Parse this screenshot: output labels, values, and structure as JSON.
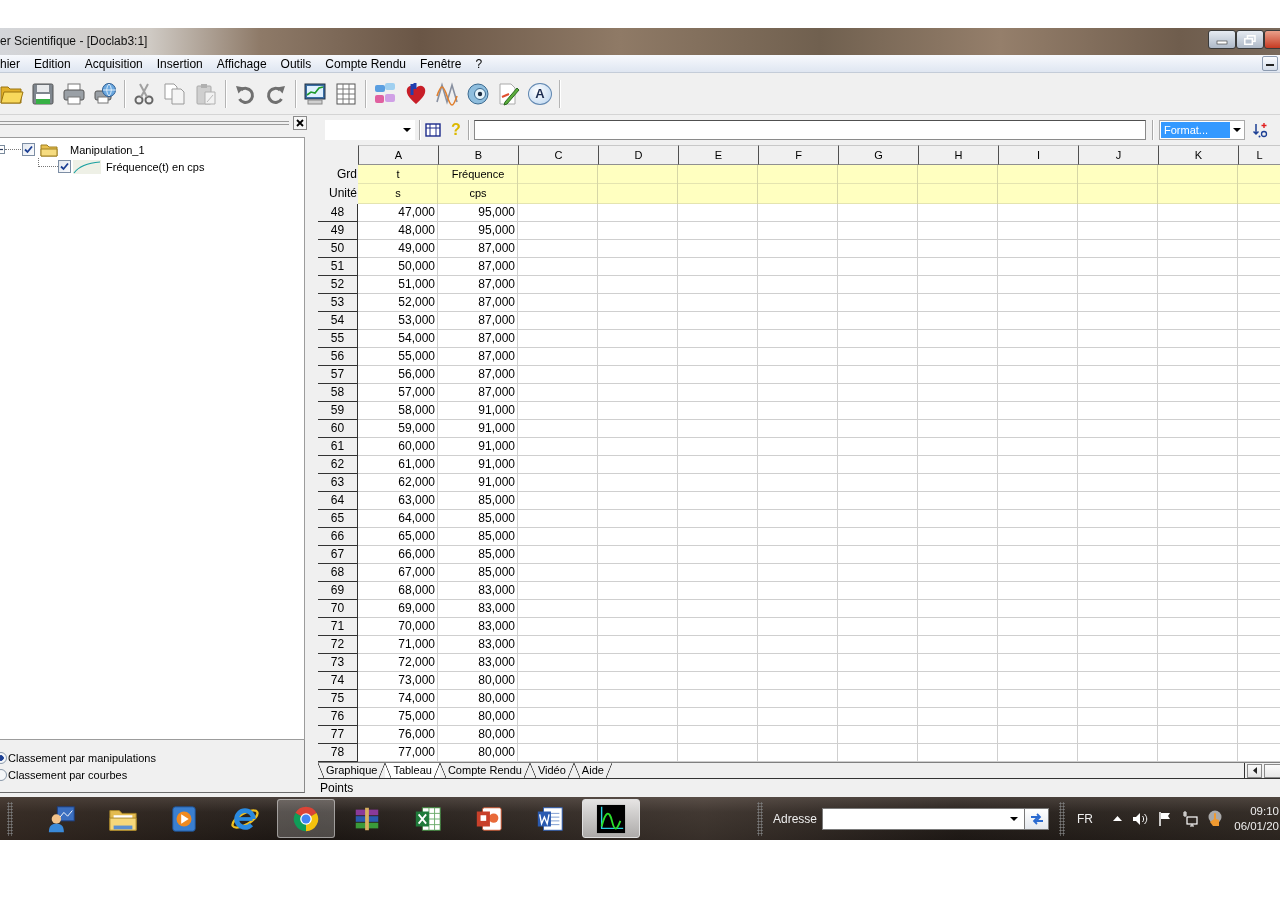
{
  "window": {
    "title": "er Scientifique - [Doclab3:1]"
  },
  "menu": [
    "hier",
    "Edition",
    "Acquisition",
    "Insertion",
    "Affichage",
    "Outils",
    "Compte Rendu",
    "Fenêtre",
    "?"
  ],
  "toolbar": [
    [
      {
        "kind": "open"
      },
      {
        "kind": "save"
      },
      {
        "kind": "print"
      },
      {
        "kind": "print-network"
      }
    ],
    [
      {
        "kind": "cut"
      },
      {
        "kind": "copy"
      },
      {
        "kind": "paste"
      }
    ],
    [
      {
        "kind": "undo"
      },
      {
        "kind": "redo"
      }
    ],
    [
      {
        "kind": "graph"
      },
      {
        "kind": "table"
      }
    ],
    [
      {
        "kind": "modules"
      },
      {
        "kind": "heart"
      },
      {
        "kind": "wave"
      },
      {
        "kind": "webcam"
      },
      {
        "kind": "pen"
      },
      {
        "kind": "text-bubble",
        "label": "A"
      }
    ]
  ],
  "explorer": {
    "tree": [
      {
        "label": "Manipulation_1",
        "checked": true,
        "expanded": true,
        "children": [
          {
            "label": "Fréquence(t) en cps",
            "checked": true
          }
        ]
      }
    ],
    "sort_options": [
      {
        "label": "Classement par manipulations",
        "selected": true
      },
      {
        "label": "Classement par courbes",
        "selected": false
      }
    ]
  },
  "formula_bar": {
    "help": "?",
    "format": "Format..."
  },
  "sheet": {
    "columns": [
      "A",
      "B",
      "C",
      "D",
      "E",
      "F",
      "G",
      "H",
      "I",
      "J",
      "K",
      "L"
    ],
    "header_rows": [
      {
        "label": "Grd",
        "cells": [
          "t",
          "Fréquence"
        ]
      },
      {
        "label": "Unité",
        "cells": [
          "s",
          "cps"
        ]
      }
    ],
    "rows": [
      {
        "number": "48",
        "cells": [
          "47,000",
          "95,000"
        ]
      },
      {
        "number": "49",
        "cells": [
          "48,000",
          "95,000"
        ]
      },
      {
        "number": "50",
        "cells": [
          "49,000",
          "87,000"
        ]
      },
      {
        "number": "51",
        "cells": [
          "50,000",
          "87,000"
        ]
      },
      {
        "number": "52",
        "cells": [
          "51,000",
          "87,000"
        ]
      },
      {
        "number": "53",
        "cells": [
          "52,000",
          "87,000"
        ]
      },
      {
        "number": "54",
        "cells": [
          "53,000",
          "87,000"
        ]
      },
      {
        "number": "55",
        "cells": [
          "54,000",
          "87,000"
        ]
      },
      {
        "number": "56",
        "cells": [
          "55,000",
          "87,000"
        ]
      },
      {
        "number": "57",
        "cells": [
          "56,000",
          "87,000"
        ]
      },
      {
        "number": "58",
        "cells": [
          "57,000",
          "87,000"
        ]
      },
      {
        "number": "59",
        "cells": [
          "58,000",
          "91,000"
        ]
      },
      {
        "number": "60",
        "cells": [
          "59,000",
          "91,000"
        ]
      },
      {
        "number": "61",
        "cells": [
          "60,000",
          "91,000"
        ]
      },
      {
        "number": "62",
        "cells": [
          "61,000",
          "91,000"
        ]
      },
      {
        "number": "63",
        "cells": [
          "62,000",
          "91,000"
        ]
      },
      {
        "number": "64",
        "cells": [
          "63,000",
          "85,000"
        ]
      },
      {
        "number": "65",
        "cells": [
          "64,000",
          "85,000"
        ]
      },
      {
        "number": "66",
        "cells": [
          "65,000",
          "85,000"
        ]
      },
      {
        "number": "67",
        "cells": [
          "66,000",
          "85,000"
        ]
      },
      {
        "number": "68",
        "cells": [
          "67,000",
          "85,000"
        ]
      },
      {
        "number": "69",
        "cells": [
          "68,000",
          "83,000"
        ]
      },
      {
        "number": "70",
        "cells": [
          "69,000",
          "83,000"
        ]
      },
      {
        "number": "71",
        "cells": [
          "70,000",
          "83,000"
        ]
      },
      {
        "number": "72",
        "cells": [
          "71,000",
          "83,000"
        ]
      },
      {
        "number": "73",
        "cells": [
          "72,000",
          "83,000"
        ]
      },
      {
        "number": "74",
        "cells": [
          "73,000",
          "80,000"
        ]
      },
      {
        "number": "75",
        "cells": [
          "74,000",
          "80,000"
        ]
      },
      {
        "number": "76",
        "cells": [
          "75,000",
          "80,000"
        ]
      },
      {
        "number": "77",
        "cells": [
          "76,000",
          "80,000"
        ]
      },
      {
        "number": "78",
        "cells": [
          "77,000",
          "80,000"
        ]
      }
    ]
  },
  "tabs": [
    {
      "label": "Graphique",
      "selected": false
    },
    {
      "label": "Tableau",
      "selected": true
    },
    {
      "label": "Compte Rendu",
      "selected": false
    },
    {
      "label": "Vidéo",
      "selected": false
    },
    {
      "label": "Aide",
      "selected": false
    }
  ],
  "status_bar": {
    "text": "Points"
  },
  "taskbar": {
    "apps": [
      {
        "kind": "person-board",
        "running": false,
        "selected": false
      },
      {
        "kind": "folder",
        "running": false,
        "selected": false
      },
      {
        "kind": "play",
        "running": false,
        "selected": false
      },
      {
        "kind": "e-logo",
        "running": false,
        "selected": false
      },
      {
        "kind": "ring-logo",
        "running": true,
        "selected": false
      },
      {
        "kind": "books",
        "running": false,
        "selected": false
      },
      {
        "kind": "spreadsheet",
        "running": false,
        "selected": false
      },
      {
        "kind": "presentation",
        "running": false,
        "selected": false
      },
      {
        "kind": "document",
        "running": false,
        "selected": false
      },
      {
        "kind": "wave-app",
        "running": true,
        "selected": true
      }
    ],
    "address_label": "Adresse",
    "language": "FR",
    "time": "09:10",
    "date": "06/01/20"
  }
}
